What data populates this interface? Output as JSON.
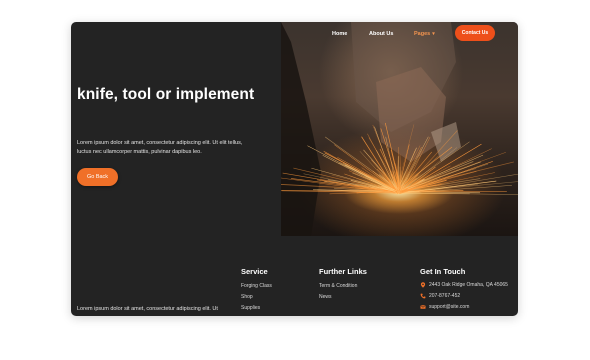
{
  "nav": {
    "home": "Home",
    "about": "About Us",
    "pages": "Pages",
    "contact": "Contact Us"
  },
  "hero": {
    "title": "knife, tool or implement",
    "text": "Lorem ipsum dolor sit amet, consectetur adipiscing elit. Ut elit tellus, luctus nec ullamcorper mattis, pulvinar dapibus leo.",
    "button": "Go Back"
  },
  "footer": {
    "about_text": "Lorem ipsum dolor sit amet, consectetur adipiscing elit. Ut",
    "service": {
      "title": "Service",
      "links": [
        "Forging Class",
        "Shop",
        "Supplies"
      ]
    },
    "further": {
      "title": "Further Links",
      "links": [
        "Term & Condition",
        "News"
      ]
    },
    "contact": {
      "title": "Get In Touch",
      "address": "2443 Oak Ridge Omaha, QA 45065",
      "phone": "207-8767-452",
      "email": "support@site.com"
    }
  },
  "colors": {
    "accent": "#ee4f1a",
    "button": "#f07028",
    "nav_active": "#f3944f",
    "background": "#232323"
  },
  "icons": {
    "address": "map-pin-icon",
    "phone": "phone-icon",
    "email": "envelope-icon",
    "dropdown": "chevron-down-icon"
  }
}
